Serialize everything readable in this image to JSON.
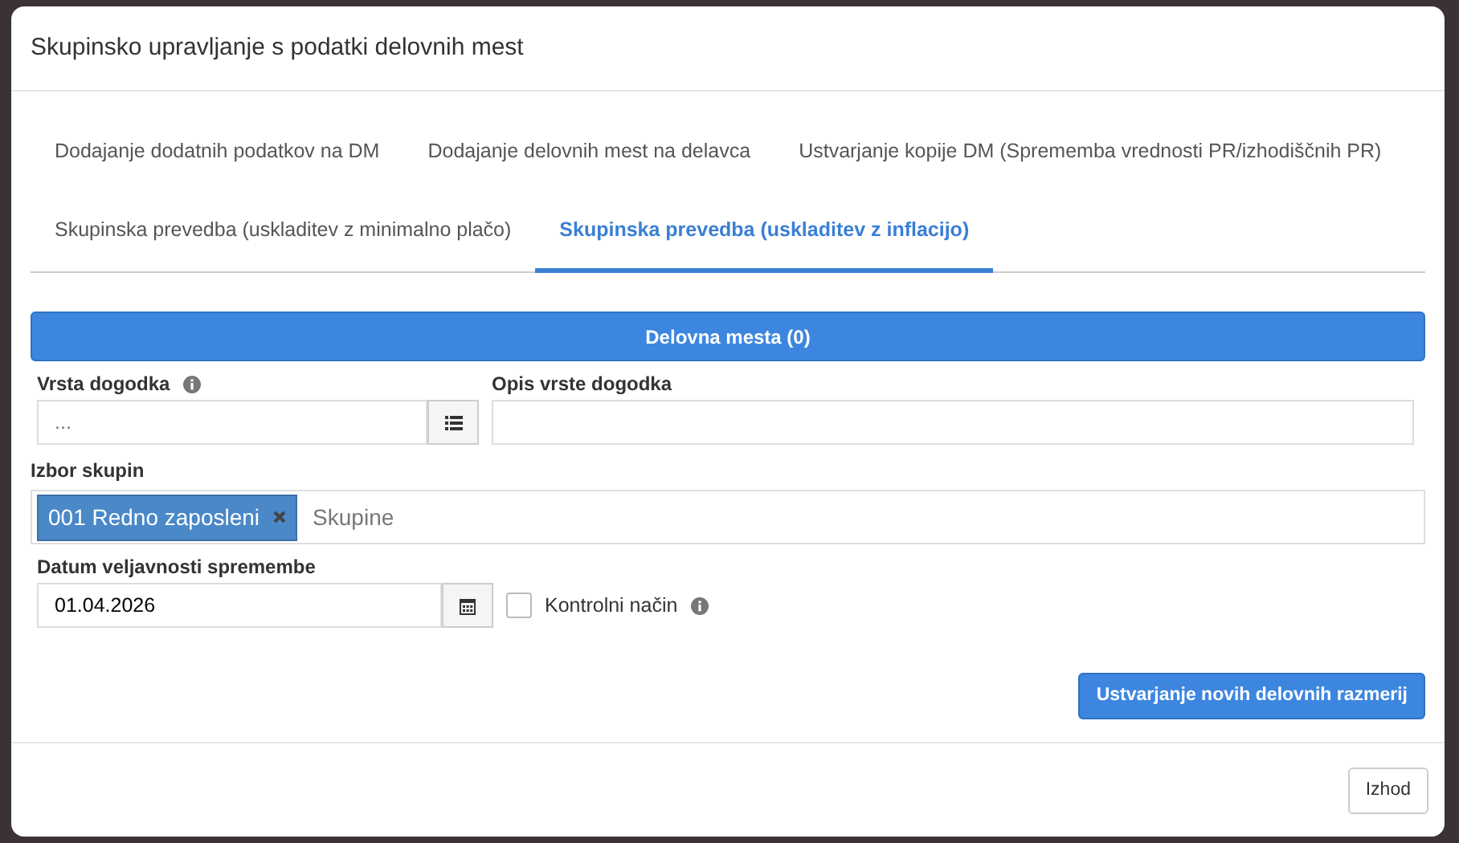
{
  "modal": {
    "title": "Skupinsko upravljanje s podatki delovnih mest"
  },
  "tabs": [
    {
      "label": "Dodajanje dodatnih podatkov na DM",
      "selected": false
    },
    {
      "label": "Dodajanje delovnih mest na delavca",
      "selected": false
    },
    {
      "label": "Ustvarjanje kopije DM (Sprememba vrednosti PR/izhodiščnih PR)",
      "selected": false
    },
    {
      "label": "Skupinska prevedba (uskladitev z minimalno plačo)",
      "selected": false
    },
    {
      "label": "Skupinska prevedba (uskladitev z inflacijo)",
      "selected": true
    }
  ],
  "section_bar": {
    "label": "Delovna mesta (0)"
  },
  "event_type": {
    "label": "Vrsta dogodka",
    "placeholder": "..."
  },
  "event_description": {
    "label": "Opis vrste dogodka"
  },
  "groups": {
    "label": "Izbor skupin",
    "tags": [
      {
        "label": "001 Redno zaposleni"
      }
    ],
    "placeholder": "Skupine"
  },
  "change_date": {
    "label": "Datum veljavnosti spremembe",
    "value": "01.04.2026"
  },
  "control_mode": {
    "label": "Kontrolni način",
    "checked": false
  },
  "create_button": {
    "label": "Ustvarjanje novih delovnih razmerij"
  },
  "exit_button": {
    "label": "Izhod"
  }
}
